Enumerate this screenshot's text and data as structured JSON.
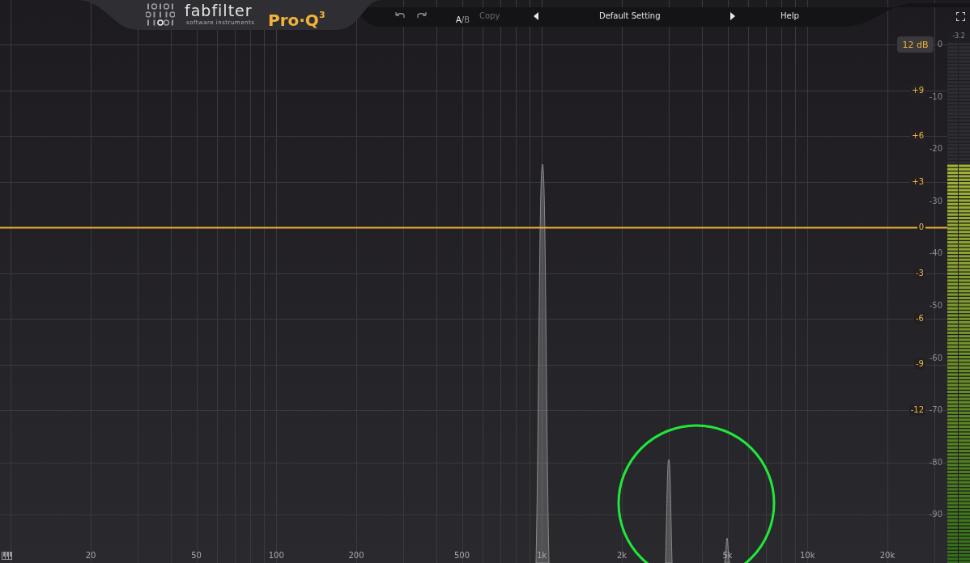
{
  "header": {
    "logo": {
      "brand": "fabfilter",
      "tagline": "software instruments",
      "product": "Pro·Q$^{3}$"
    },
    "ab": [
      {
        "label": "A",
        "selected": true
      },
      {
        "label": "B",
        "selected": false
      }
    ],
    "ab_separator": "/",
    "copy": {
      "label": "Copy",
      "disabled": true
    },
    "preset": "Default Setting",
    "help": "Help"
  },
  "graph": {
    "range_button": "12 dB",
    "gain_labels": [
      "+9",
      "+6",
      "+3",
      "0",
      "-3",
      "-6",
      "-9",
      "-12"
    ],
    "spectrum_labels": [
      "0",
      "-10",
      "-20",
      "-30",
      "-40",
      "-50",
      "-60",
      "-70",
      "-80",
      "-90"
    ],
    "freq_labels": [
      "20",
      "50",
      "100",
      "200",
      "500",
      "1k",
      "2k",
      "5k",
      "10k",
      "20k"
    ]
  },
  "meter": {
    "reading": "-3.2",
    "level": 0.77
  }
}
